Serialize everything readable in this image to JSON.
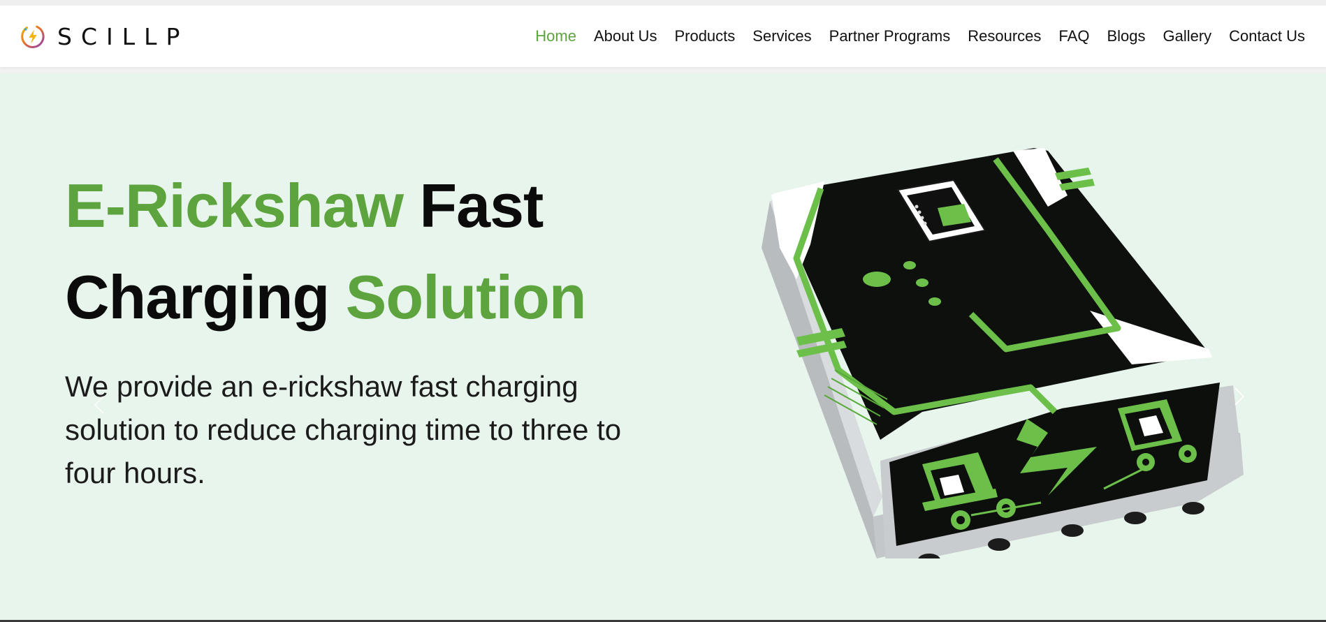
{
  "brand": {
    "name": "SCILLP",
    "logo_icon": "lightning-bolt-ring-icon"
  },
  "nav": {
    "items": [
      {
        "label": "Home",
        "active": true
      },
      {
        "label": "About Us"
      },
      {
        "label": "Products"
      },
      {
        "label": "Services"
      },
      {
        "label": "Partner Programs"
      },
      {
        "label": "Resources"
      },
      {
        "label": "FAQ"
      },
      {
        "label": "Blogs"
      },
      {
        "label": "Gallery"
      },
      {
        "label": "Contact Us"
      }
    ]
  },
  "hero": {
    "title_green_1": "E-Rickshaw",
    "title_dark_1": "Fast",
    "title_dark_2": "Charging",
    "title_green_2": "Solution",
    "description": "We provide an e-rickshaw fast charging solution to reduce charging time to three to four hours.",
    "image_icon": "e-rickshaw-charger-product-image",
    "prev_icon": "chevron-left-icon",
    "next_icon": "chevron-right-icon"
  },
  "colors": {
    "accent_green": "#5da33e",
    "hero_background": "#e8f5ec",
    "text_dark": "#0b0b0b"
  }
}
